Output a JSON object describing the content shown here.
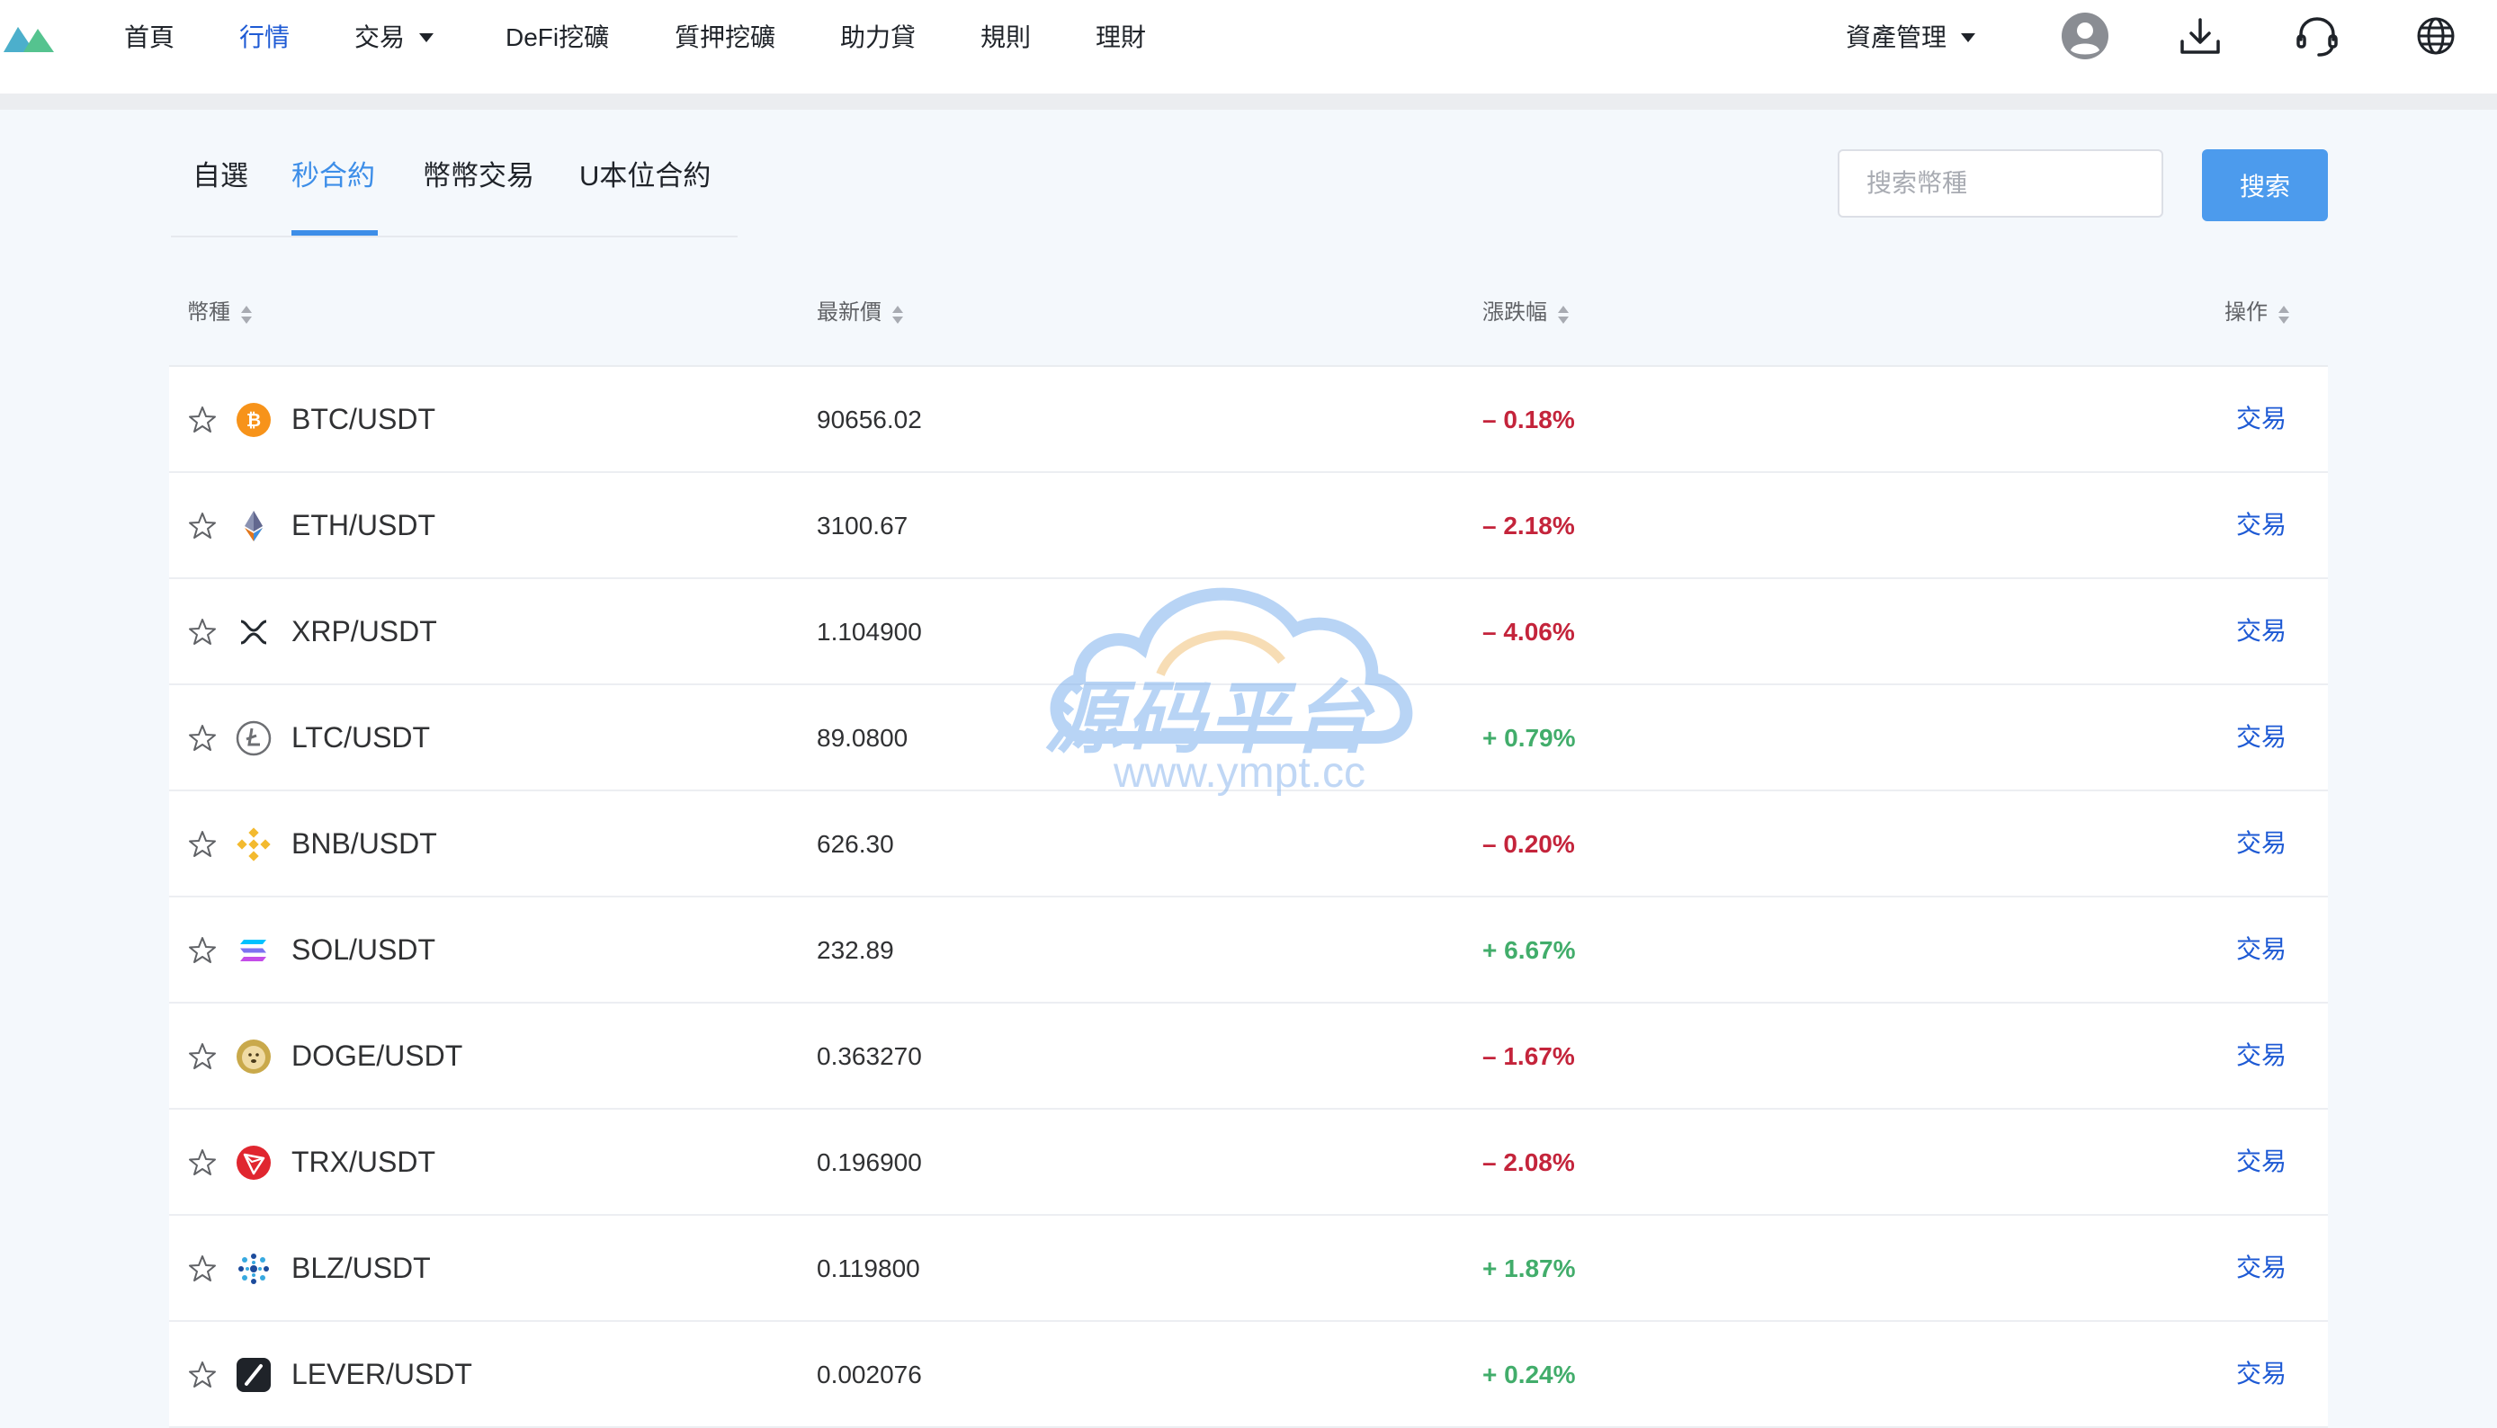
{
  "nav": {
    "items": [
      {
        "label": "首頁",
        "active": false
      },
      {
        "label": "行情",
        "active": true
      },
      {
        "label": "交易",
        "active": false,
        "dropdown": true
      },
      {
        "label": "DeFi挖礦",
        "active": false
      },
      {
        "label": "質押挖礦",
        "active": false
      },
      {
        "label": "助力貸",
        "active": false
      },
      {
        "label": "規則",
        "active": false
      },
      {
        "label": "理財",
        "active": false
      }
    ],
    "asset_menu": "資產管理",
    "icons": [
      "user-avatar-icon",
      "download-icon",
      "customer-service-icon",
      "globe-icon"
    ]
  },
  "tabs": [
    {
      "label": "自選",
      "active": false
    },
    {
      "label": "秒合約",
      "active": true
    },
    {
      "label": "幣幣交易",
      "active": false
    },
    {
      "label": "U本位合約",
      "active": false
    }
  ],
  "search": {
    "placeholder": "搜索幣種",
    "value": "",
    "button_label": "搜索"
  },
  "table": {
    "headers": {
      "coin": "幣種",
      "price": "最新價",
      "change": "漲跌幅",
      "action": "操作"
    },
    "rows": [
      {
        "pair": "BTC/USDT",
        "price": "90656.02",
        "change": "– 0.18%",
        "direction": "down",
        "action": "交易",
        "logo": "bitcoin-logo"
      },
      {
        "pair": "ETH/USDT",
        "price": "3100.67",
        "change": "– 2.18%",
        "direction": "down",
        "action": "交易",
        "logo": "ethereum-logo"
      },
      {
        "pair": "XRP/USDT",
        "price": "1.104900",
        "change": "– 4.06%",
        "direction": "down",
        "action": "交易",
        "logo": "xrp-logo"
      },
      {
        "pair": "LTC/USDT",
        "price": "89.0800",
        "change": "+ 0.79%",
        "direction": "up",
        "action": "交易",
        "logo": "litecoin-logo"
      },
      {
        "pair": "BNB/USDT",
        "price": "626.30",
        "change": "– 0.20%",
        "direction": "down",
        "action": "交易",
        "logo": "bnb-logo"
      },
      {
        "pair": "SOL/USDT",
        "price": "232.89",
        "change": "+ 6.67%",
        "direction": "up",
        "action": "交易",
        "logo": "solana-logo"
      },
      {
        "pair": "DOGE/USDT",
        "price": "0.363270",
        "change": "– 1.67%",
        "direction": "down",
        "action": "交易",
        "logo": "dogecoin-logo"
      },
      {
        "pair": "TRX/USDT",
        "price": "0.196900",
        "change": "– 2.08%",
        "direction": "down",
        "action": "交易",
        "logo": "tron-logo"
      },
      {
        "pair": "BLZ/USDT",
        "price": "0.119800",
        "change": "+ 1.87%",
        "direction": "up",
        "action": "交易",
        "logo": "bluzelle-logo"
      },
      {
        "pair": "LEVER/USDT",
        "price": "0.002076",
        "change": "+ 0.24%",
        "direction": "up",
        "action": "交易",
        "logo": "lever-logo"
      }
    ]
  },
  "watermark": {
    "title": "源码平台",
    "url": "www.ympt.cc"
  },
  "colors": {
    "accent": "#1e5ad4",
    "tab_active": "#3d8ee8",
    "down": "#c4243b",
    "up": "#42ad6b",
    "search_button": "#4c9bed"
  }
}
